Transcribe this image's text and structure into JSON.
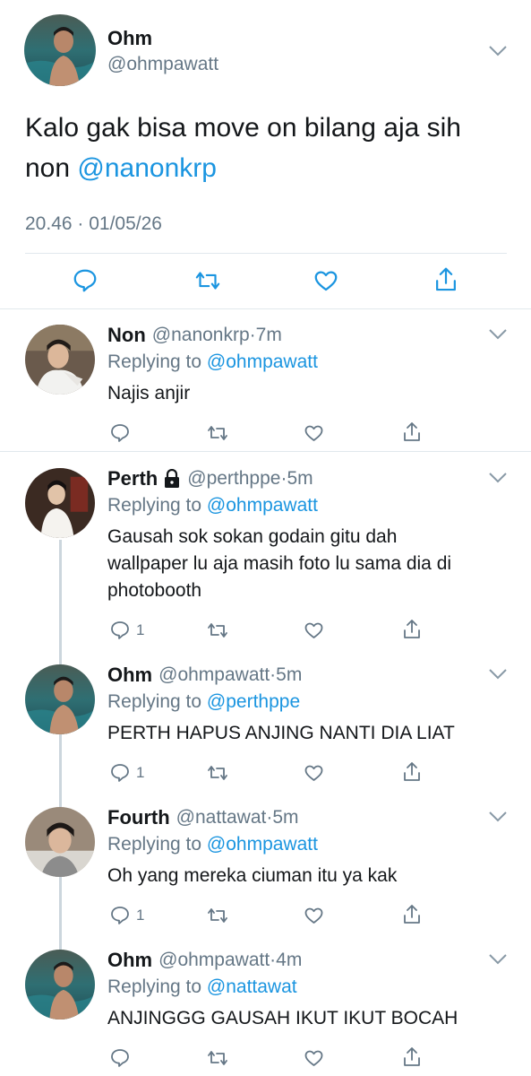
{
  "colors": {
    "accent": "#1b95e0",
    "secondary": "#657786",
    "text": "#14171a",
    "divider": "#e1e8ed"
  },
  "main_tweet": {
    "name": "Ohm",
    "handle": "@ohmpawatt",
    "text_line1": "Kalo gak bisa move on bilang aja sih",
    "text_line2_prefix": "non",
    "mention": "@nanonkrp",
    "timestamp": "20.46 · 01/05/26",
    "actions": [
      "reply-icon",
      "retweet-icon",
      "like-icon",
      "share-icon"
    ]
  },
  "replies": [
    {
      "name": "Non",
      "handle": "@nanonkrp",
      "time": "·7m",
      "replying_label": "Replying to",
      "replying_to": "@ohmpawatt",
      "lines": [
        "Najis anjir"
      ],
      "reply_count": ""
    },
    {
      "name": "Perth",
      "locked": true,
      "handle": "@perthppe",
      "time": "·5m",
      "replying_label": "Replying to",
      "replying_to": "@ohmpawatt",
      "lines": [
        "Gausah sok sokan godain gitu dah",
        "wallpaper lu aja masih foto lu sama dia di",
        "photobooth"
      ],
      "reply_count": "1"
    },
    {
      "name": "Ohm",
      "handle": "@ohmpawatt",
      "time": "·5m",
      "replying_label": "Replying to",
      "replying_to": "@perthppe",
      "lines": [
        "PERTH HAPUS ANJING NANTI DIA LIAT"
      ],
      "reply_count": "1"
    },
    {
      "name": "Fourth",
      "handle": "@nattawat",
      "time": "·5m",
      "replying_label": "Replying to",
      "replying_to": "@ohmpawatt",
      "lines": [
        "Oh yang mereka ciuman itu ya kak"
      ],
      "reply_count": "1"
    },
    {
      "name": "Ohm",
      "handle": "@ohmpawatt",
      "time": "·4m",
      "replying_label": "Replying to",
      "replying_to": "@nattawat",
      "lines": [
        "ANJINGGG GAUSAH IKUT IKUT BOCAH"
      ],
      "reply_count": ""
    }
  ]
}
